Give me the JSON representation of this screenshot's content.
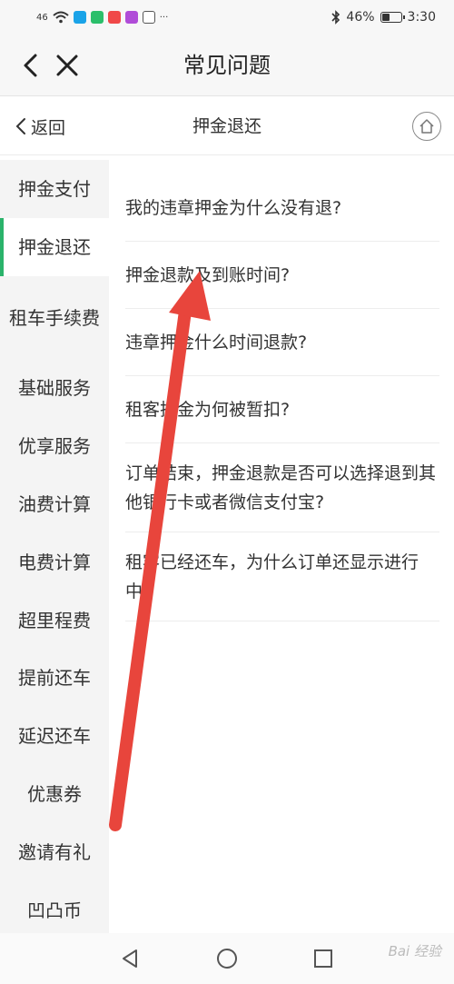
{
  "status_bar": {
    "signal_text": "46",
    "battery_percent": "46%",
    "battery_level": 0.46,
    "time": "3:30",
    "more": "···"
  },
  "app_bar": {
    "title": "常见问题",
    "back_icon": "chevron-left-icon",
    "close_icon": "close-icon"
  },
  "sub_header": {
    "return_label": "返回",
    "title": "押金退还",
    "home_icon": "home-icon"
  },
  "sidebar": {
    "items": [
      {
        "label": "押金支付"
      },
      {
        "label": "押金退还"
      },
      {
        "label": "租车手续费"
      },
      {
        "label": "基础服务"
      },
      {
        "label": "优享服务"
      },
      {
        "label": "油费计算"
      },
      {
        "label": "电费计算"
      },
      {
        "label": "超里程费"
      },
      {
        "label": "提前还车"
      },
      {
        "label": "延迟还车"
      },
      {
        "label": "优惠券"
      },
      {
        "label": "邀请有礼"
      },
      {
        "label": "凹凸币"
      }
    ],
    "active_index": 1
  },
  "questions": [
    {
      "text": "我的违章押金为什么没有退?"
    },
    {
      "text": "押金退款及到账时间?"
    },
    {
      "text": "违章押金什么时间退款?"
    },
    {
      "text": "租客押金为何被暂扣?"
    },
    {
      "text": "订单结束，押金退款是否可以选择退到其他银行卡或者微信支付宝?"
    },
    {
      "text": "租客已经还车，为什么订单还显示进行中?"
    }
  ],
  "annotation": {
    "color": "#e8453c"
  },
  "nav_bar": {
    "back_icon": "triangle-back-icon",
    "home_icon": "circle-home-icon",
    "recents_icon": "square-recents-icon"
  },
  "watermark": {
    "text": "Bai 经验"
  },
  "colors": {
    "accent": "#2bb36b",
    "sidebar_bg": "#f4f4f4"
  }
}
